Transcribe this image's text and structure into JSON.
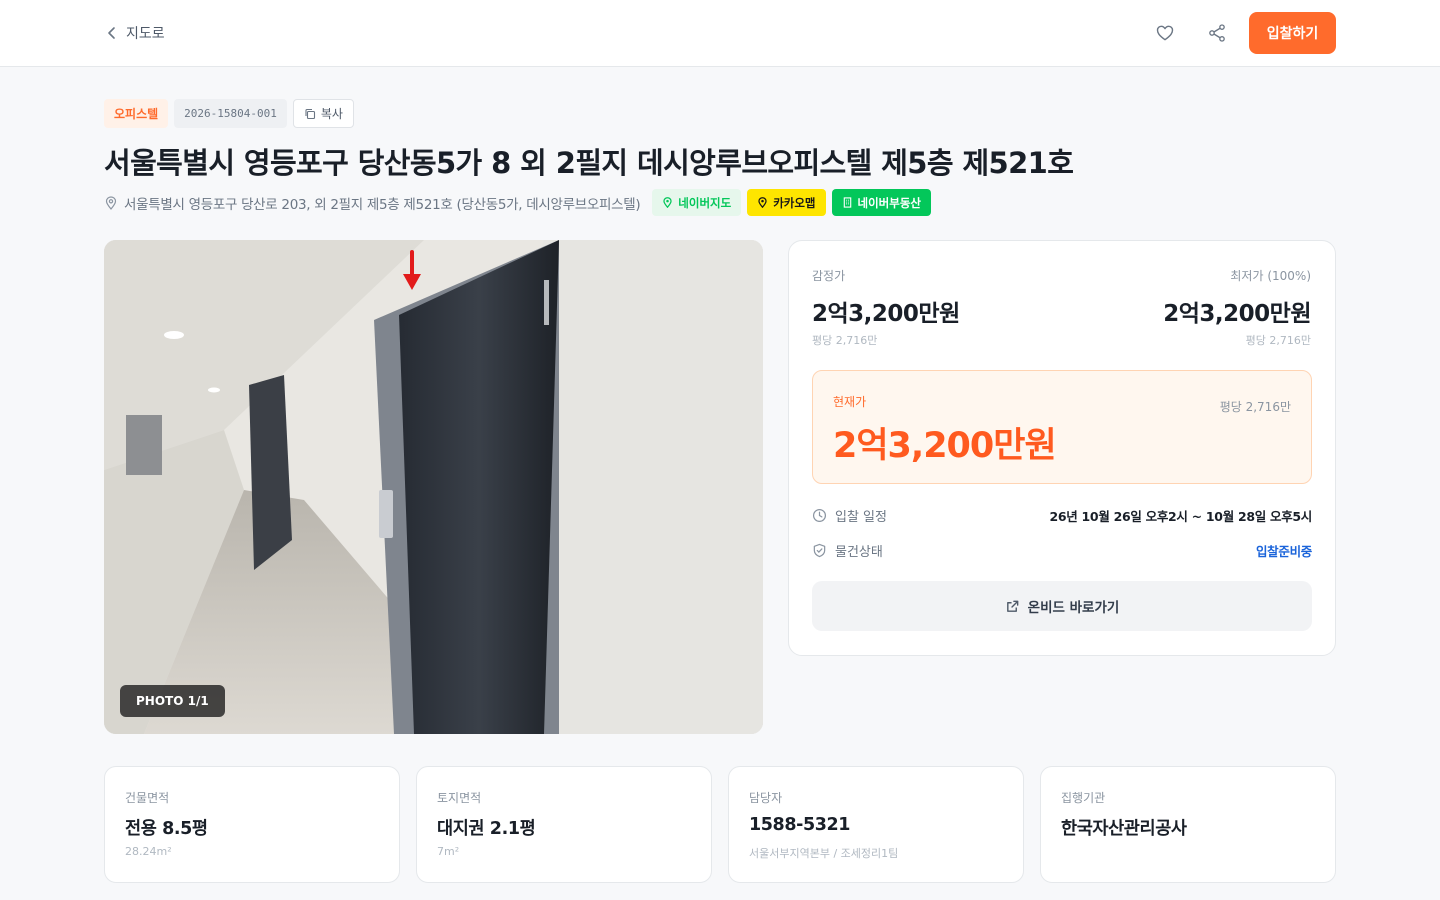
{
  "header": {
    "back_label": "지도로",
    "bid_button": "입찰하기"
  },
  "tags": {
    "type": "오피스텔",
    "case_no": "2026-15804-001",
    "copy_label": "복사"
  },
  "title": "서울특별시 영등포구 당산동5가 8 외 2필지 데시앙루브오피스텔 제5층 제521호",
  "address": "서울특별시 영등포구 당산로 203, 외 2필지 제5층 제521호 (당산동5가, 데시앙루브오피스텔)",
  "map_buttons": {
    "naver_map": "네이버지도",
    "kakao_map": "카카오맵",
    "naver_land": "네이버부동산"
  },
  "photo": {
    "badge": "PHOTO 1/1"
  },
  "price": {
    "appraisal_label": "감정가",
    "appraisal_value": "2억3,200만원",
    "appraisal_per": "평당 2,716만",
    "min_label": "최저가 (100%)",
    "min_value": "2억3,200만원",
    "min_per": "평당 2,716만",
    "current_label": "현재가",
    "current_value": "2억3,200만원",
    "current_per": "평당 2,716만",
    "schedule_label": "입찰 일정",
    "schedule_value": "26년 10월 26일 오후2시 ~ 10월 28일 오후5시",
    "status_label": "물건상태",
    "status_value": "입찰준비중",
    "onbid_button": "온비드 바로가기"
  },
  "cards": [
    {
      "label": "건물면적",
      "value": "전용 8.5평",
      "sub": "28.24m²"
    },
    {
      "label": "토지면적",
      "value": "대지권 2.1평",
      "sub": "7m²"
    },
    {
      "label": "담당자",
      "value": "1588-5321",
      "sub": "서울서부지역본부 / 조세정리1팀"
    },
    {
      "label": "집행기관",
      "value": "한국자산관리공사",
      "sub": ""
    }
  ],
  "colors": {
    "accent": "#ff6b2c",
    "current_price": "#ff5a1f",
    "status_blue": "#1b64da",
    "naver_green": "#03c75a",
    "kakao_yellow": "#fee500"
  }
}
